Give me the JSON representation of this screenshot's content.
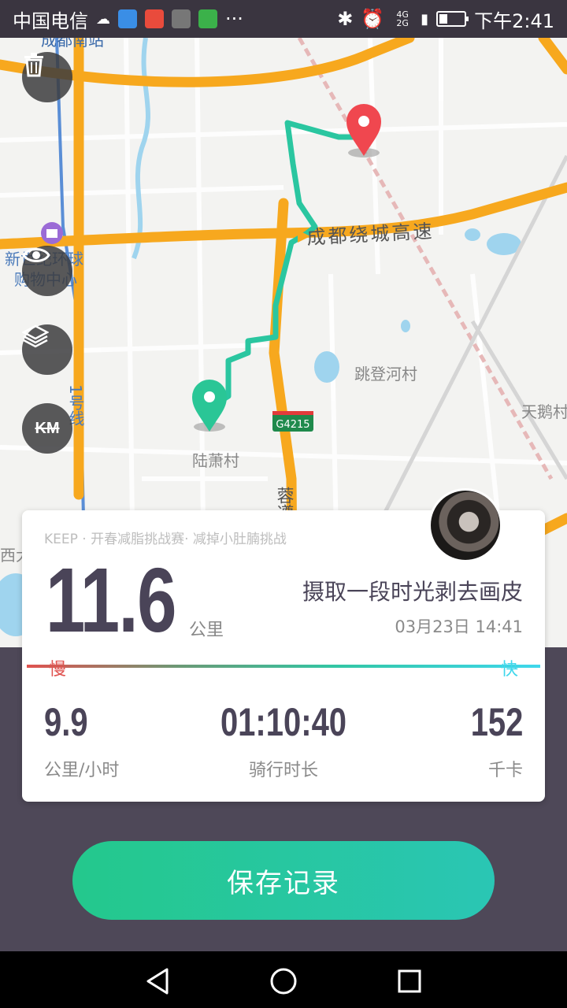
{
  "status_bar": {
    "carrier": "中国电信",
    "network": "4G 2G",
    "time": "下午2:41",
    "icons": [
      "cloud-icon",
      "app-icon",
      "weibo-icon",
      "app-icon",
      "app-icon",
      "more-icon",
      "bluetooth-icon",
      "alarm-icon",
      "signal-icon",
      "battery-icon"
    ]
  },
  "map": {
    "labels": {
      "station": "成都南站",
      "mall_line1": "新世纪环球",
      "mall_line2": "购物中心",
      "highway": "成都绕城高速",
      "village_east": "跳登河村",
      "village_west": "陆萧村",
      "shield": "G4215",
      "road_name": "蓉遵",
      "metro": "1号线",
      "far_east": "天鹅村",
      "far_west": "西大"
    },
    "controls": {
      "delete_icon": "trash-icon",
      "visibility_icon": "eye-icon",
      "layers_icon": "layers-icon",
      "km_label": "KM"
    },
    "colors": {
      "route": "#2ac6a0",
      "highway": "#f7a81e",
      "start_pin": "#2ac696",
      "end_pin": "#f0474f"
    }
  },
  "summary": {
    "challenge": "KEEP · 开春减脂挑战赛· 减掉小肚腩挑战",
    "distance": "11.6",
    "distance_unit": "公里",
    "motto": "摄取一段时光剥去画皮",
    "datetime": "03月23日 14:41",
    "speed_slow": "慢",
    "speed_fast": "快",
    "stats": {
      "speed": {
        "value": "9.9",
        "label": "公里/小时"
      },
      "duration": {
        "value": "01:10:40",
        "label": "骑行时长"
      },
      "calories": {
        "value": "152",
        "label": "千卡"
      }
    }
  },
  "save_label": "保存记录"
}
